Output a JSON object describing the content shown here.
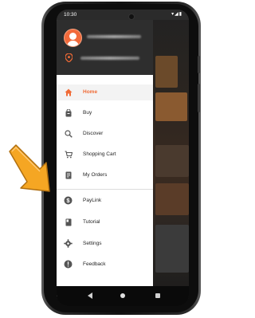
{
  "status_bar": {
    "time": "10:30",
    "icons": "▾◢▮"
  },
  "drawer": {
    "menu_items": [
      {
        "label": "Home",
        "icon": "home-icon",
        "active": true
      },
      {
        "label": "Buy",
        "icon": "shopping-bag-icon"
      },
      {
        "label": "Discover",
        "icon": "search-icon"
      },
      {
        "label": "Shopping Cart",
        "icon": "cart-icon"
      },
      {
        "label": "My Orders",
        "icon": "orders-icon"
      },
      {
        "label": "PayLink",
        "icon": "dollar-circle-icon"
      },
      {
        "label": "Tutorial",
        "icon": "book-icon"
      },
      {
        "label": "Settings",
        "icon": "gear-icon"
      },
      {
        "label": "Feedback",
        "icon": "exclamation-icon"
      }
    ]
  },
  "colors": {
    "accent": "#f06a35",
    "arrow": "#f5a623"
  }
}
